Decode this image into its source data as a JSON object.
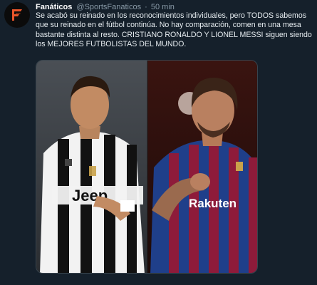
{
  "tweet": {
    "display_name": "Fanáticos",
    "handle": "@SportsFanaticos",
    "separator": "·",
    "time": "50 min",
    "text_lines": [
      "Se acabó su reinado en los reconocimientos individuales, pero TODOS sabemos",
      "que su reinado en el fútbol continúa. No hay comparación, comen en una mesa",
      "bastante distinta al resto. CRISTIANO RONALDO Y LIONEL MESSI siguen siendo",
      "los MEJORES FUTBOLISTAS DEL MUNDO."
    ],
    "media": {
      "left_shirt_text": "Jeep",
      "right_shirt_text": "Rakuten"
    }
  },
  "colors": {
    "background": "#15202b",
    "text": "#e6ecf0",
    "muted": "#8899a6",
    "brand_orange": "#e8552a",
    "juventus_black": "#111111",
    "juventus_white": "#f2f2f2",
    "barca_blue": "#1f3f8a",
    "barca_red": "#8e1b3a"
  },
  "icons": {
    "avatar": "fanaticos-logo-icon"
  }
}
